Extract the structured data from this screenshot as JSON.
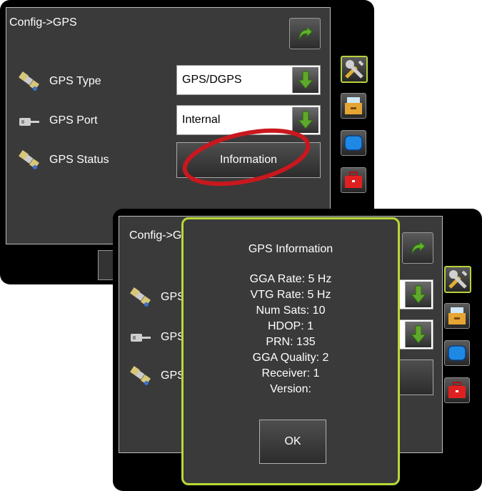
{
  "back_screen": {
    "title": "Config->GPS",
    "rows": [
      {
        "label": "GPS Type",
        "value": "GPS/DGPS",
        "icon": "satellite-icon"
      },
      {
        "label": "GPS Port",
        "value": "Internal",
        "icon": "gps-port-icon"
      },
      {
        "label": "GPS Status",
        "button": "Information",
        "icon": "satellite-icon"
      }
    ]
  },
  "front_screen": {
    "title": "Config->GPS",
    "rows": [
      {
        "label": "GPS Type"
      },
      {
        "label": "GPS Port"
      },
      {
        "label": "GPS Status"
      }
    ]
  },
  "popup": {
    "title": "GPS Information",
    "lines": [
      "GGA Rate: 5 Hz",
      "VTG Rate: 5 Hz",
      "Num Sats: 10",
      "HDOP: 1",
      "PRN: 135",
      "GGA Quality: 2",
      "Receiver: 1",
      "Version:"
    ],
    "ok_label": "OK"
  },
  "side_tabs": [
    "tools-icon",
    "storage-icon",
    "display-icon",
    "toolbox-icon"
  ],
  "colors": {
    "popup_border": "#b8d936",
    "highlight_oval": "#c8181e",
    "arrow_green": "#5fa82a",
    "panel_bg": "#3a3a3a"
  }
}
